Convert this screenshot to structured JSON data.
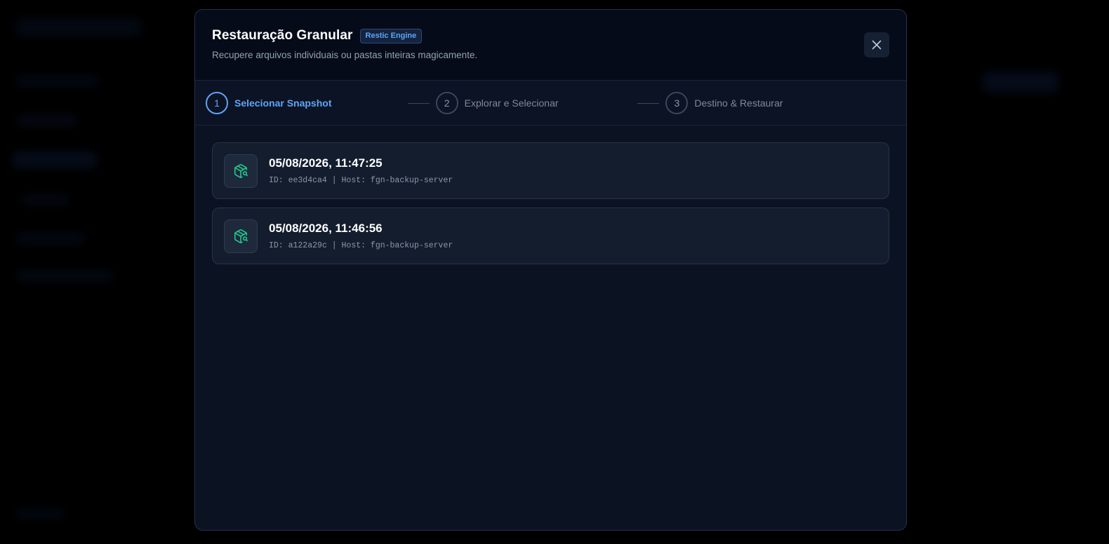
{
  "modal": {
    "title": "Restauração Granular",
    "badge": "Restic Engine",
    "subtitle": "Recupere arquivos individuais ou pastas inteiras magicamente.",
    "close_icon": "close-icon"
  },
  "steps": [
    {
      "number": "1",
      "label": "Selecionar Snapshot",
      "active": true
    },
    {
      "number": "2",
      "label": "Explorar e Selecionar",
      "active": false
    },
    {
      "number": "3",
      "label": "Destino & Restaurar",
      "active": false
    }
  ],
  "snapshots": [
    {
      "date": "05/08/2026, 11:47:25",
      "meta": "ID: ee3d4ca4 | Host: fgn-backup-server",
      "icon": "package-search-icon"
    },
    {
      "date": "05/08/2026, 11:46:56",
      "meta": "ID: a122a29c | Host: fgn-backup-server",
      "icon": "package-search-icon"
    }
  ],
  "colors": {
    "accent": "#5fa5f5",
    "icon_green": "#22c58b",
    "modal_bg": "#0b1221"
  }
}
